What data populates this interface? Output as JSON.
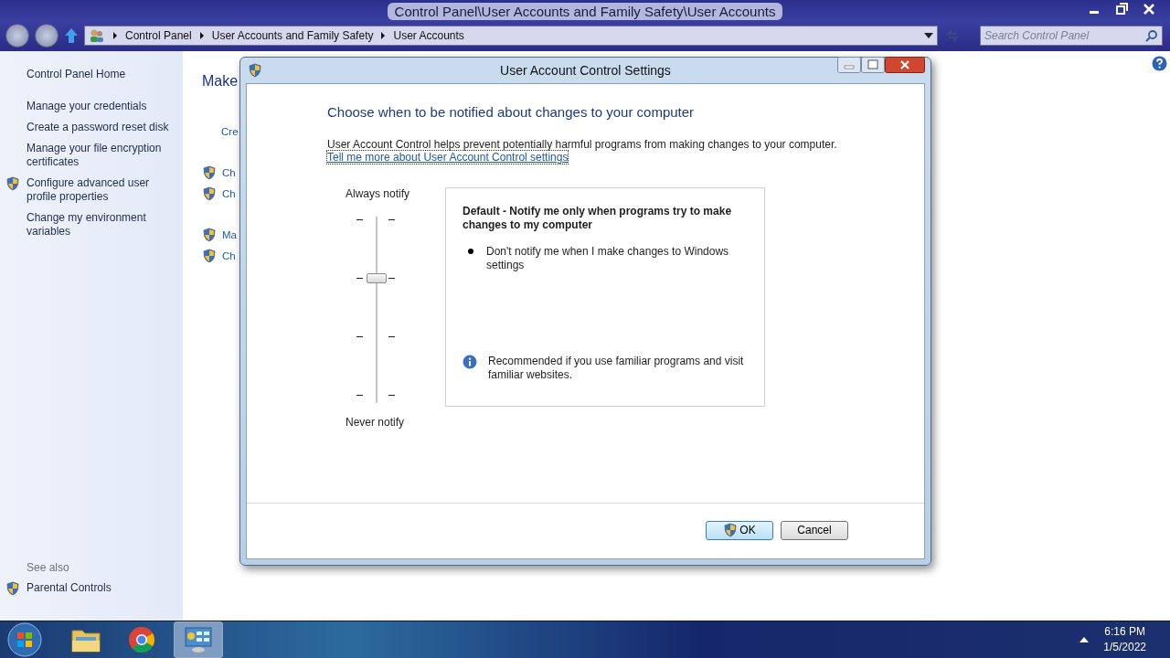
{
  "window": {
    "title": "Control Panel\\User Accounts and Family Safety\\User Accounts"
  },
  "address_bar": {
    "breadcrumbs": [
      "Control Panel",
      "User Accounts and Family Safety",
      "User Accounts"
    ]
  },
  "search": {
    "placeholder": "Search Control Panel"
  },
  "sidebar": {
    "home": "Control Panel Home",
    "items": [
      {
        "label": "Manage your credentials",
        "shield": false
      },
      {
        "label": "Create a password reset disk",
        "shield": false
      },
      {
        "label": "Manage your file encryption certificates",
        "shield": false
      },
      {
        "label": "Configure advanced user profile properties",
        "shield": true
      },
      {
        "label": "Change my environment variables",
        "shield": false
      }
    ],
    "see_also_heading": "See also",
    "see_also": [
      {
        "label": "Parental Controls",
        "shield": true
      }
    ]
  },
  "main": {
    "heading": "Make",
    "groups": [
      [
        {
          "label": "Cre",
          "shield": false
        }
      ],
      [
        {
          "label": "Ch",
          "shield": true
        },
        {
          "label": "Ch",
          "shield": true
        }
      ],
      [
        {
          "label": "Ma",
          "shield": true
        },
        {
          "label": "Ch",
          "shield": true
        }
      ]
    ]
  },
  "dialog": {
    "title": "User Account Control Settings",
    "heading": "Choose when to be notified about changes to your computer",
    "description": "User Account Control helps prevent potentially harmful programs from making changes to your computer.",
    "link": "Tell me more about User Account Control settings",
    "slider": {
      "top_label": "Always notify",
      "bottom_label": "Never notify",
      "level": 0.67
    },
    "info_box": {
      "title": "Default - Notify me only when programs try to make changes to my computer",
      "bullets": [
        "Don't notify me when I make changes to Windows settings"
      ],
      "note": "Recommended if you use familiar programs and visit familiar websites."
    },
    "buttons": [
      {
        "label": "OK",
        "shield": true,
        "default": true
      },
      {
        "label": "Cancel",
        "shield": false,
        "default": false
      }
    ]
  },
  "taskbar": {
    "apps": [
      {
        "kind": "folder",
        "active": false
      },
      {
        "kind": "browser",
        "active": false
      },
      {
        "kind": "control-panel",
        "active": true
      }
    ],
    "clock": {
      "time": "6:16 PM",
      "date": "1/5/2022"
    }
  }
}
